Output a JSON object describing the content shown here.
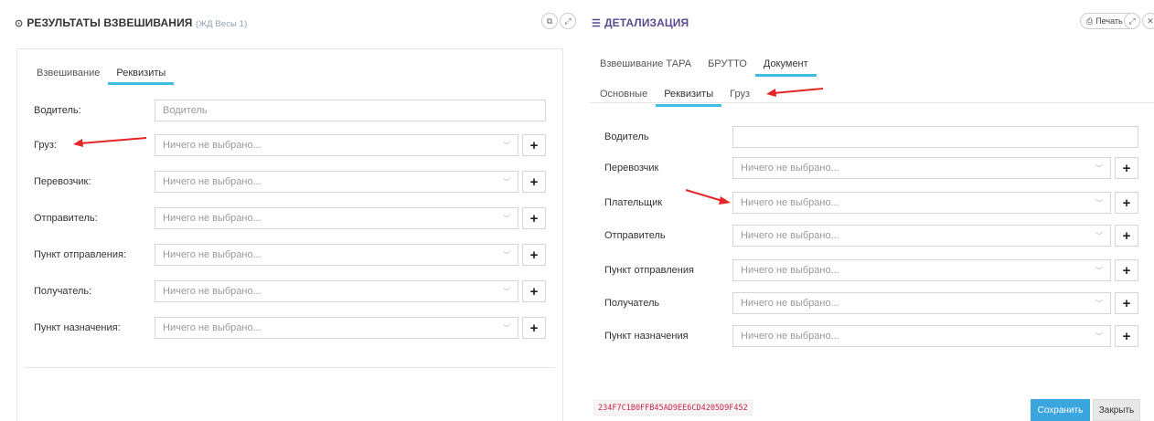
{
  "left": {
    "title": "РЕЗУЛЬТАТЫ ВЗВЕШИВАНИЯ",
    "subtitle": "(ЖД Весы 1)",
    "tabs": [
      {
        "label": "Взвешивание",
        "active": false
      },
      {
        "label": "Реквизиты",
        "active": true
      }
    ],
    "fields": [
      {
        "label": "Водитель:",
        "value": "Водитель",
        "type": "text"
      },
      {
        "label": "Груз:",
        "value": "Ничего не выбрано...",
        "type": "select"
      },
      {
        "label": "Перевозчик:",
        "value": "Ничего не выбрано...",
        "type": "select"
      },
      {
        "label": "Отправитель:",
        "value": "Ничего не выбрано...",
        "type": "select"
      },
      {
        "label": "Пункт отправления:",
        "value": "Ничего не выбрано...",
        "type": "select"
      },
      {
        "label": "Получатель:",
        "value": "Ничего не выбрано...",
        "type": "select"
      },
      {
        "label": "Пункт назначения:",
        "value": "Ничего не выбрано...",
        "type": "select"
      }
    ]
  },
  "right": {
    "title": "ДЕТАЛИЗАЦИЯ",
    "print_label": "Печать",
    "tabs_top": [
      {
        "label": "Взвешивание ТАРА",
        "active": false
      },
      {
        "label": "БРУТТО",
        "active": false
      },
      {
        "label": "Документ",
        "active": true
      }
    ],
    "tabs_sub": [
      {
        "label": "Основные",
        "active": false
      },
      {
        "label": "Реквизиты",
        "active": true
      },
      {
        "label": "Груз",
        "active": false
      }
    ],
    "fields": [
      {
        "label": "Водитель",
        "value": "",
        "type": "text"
      },
      {
        "label": "Перевозчик",
        "value": "Ничего не выбрано...",
        "type": "select"
      },
      {
        "label": "Плательщик",
        "value": "Ничего не выбрано...",
        "type": "select"
      },
      {
        "label": "Отправитель",
        "value": "Ничего не выбрано...",
        "type": "select"
      },
      {
        "label": "Пункт отправления",
        "value": "Ничего не выбрано...",
        "type": "select"
      },
      {
        "label": "Получатель",
        "value": "Ничего не выбрано...",
        "type": "select"
      },
      {
        "label": "Пункт назначения",
        "value": "Ничего не выбрано...",
        "type": "select"
      }
    ],
    "hash": "234F7C1B0FFB45AD9EE6CD4205D9F452",
    "save_label": "Сохранить",
    "close_label": "Закрыть"
  },
  "colors": {
    "accent": "#3dbde0",
    "primary_button": "#3aa6dd",
    "annotation_arrow": "#e32626",
    "hash_text": "#c7254e"
  },
  "icons": [
    "gauge-icon",
    "external-link-icon",
    "expand-icon",
    "database-icon",
    "print-icon",
    "chevron-down-icon",
    "plus-icon"
  ]
}
